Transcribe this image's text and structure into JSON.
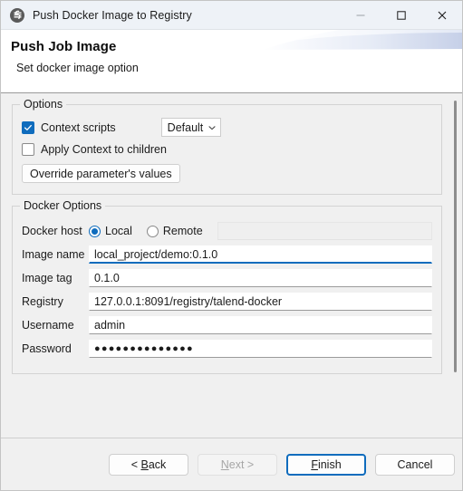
{
  "window": {
    "title": "Push Docker Image to Registry",
    "icon": "talend-logo-icon",
    "controls": {
      "minimize": "minimize-icon",
      "maximize": "maximize-icon",
      "close": "close-icon"
    }
  },
  "header": {
    "title": "Push Job Image",
    "subtitle": "Set docker image option"
  },
  "options": {
    "group_title": "Options",
    "context_scripts": {
      "label": "Context scripts",
      "checked": true
    },
    "context_combo": {
      "value": "Default",
      "arrow": "chevron-down-icon"
    },
    "apply_context": {
      "label": "Apply Context to children",
      "checked": false
    },
    "override_button": "Override parameter's values"
  },
  "docker": {
    "group_title": "Docker Options",
    "host": {
      "label": "Docker host",
      "local_label": "Local",
      "remote_label": "Remote",
      "selected": "Local",
      "remote_value": ""
    },
    "fields": [
      {
        "label": "Image name",
        "value": "local_project/demo:0.1.0",
        "focused": true,
        "type": "text"
      },
      {
        "label": "Image tag",
        "value": "0.1.0",
        "focused": false,
        "type": "text"
      },
      {
        "label": "Registry",
        "value": "127.0.0.1:8091/registry/talend-docker",
        "focused": false,
        "type": "text"
      },
      {
        "label": "Username",
        "value": "admin",
        "focused": false,
        "type": "text"
      },
      {
        "label": "Password",
        "value": "●●●●●●●●●●●●●●",
        "focused": false,
        "type": "password"
      }
    ]
  },
  "footer": {
    "back": {
      "pre": "< ",
      "mnemonic": "B",
      "post": "ack"
    },
    "next": {
      "pre": "",
      "mnemonic": "N",
      "post": "ext >"
    },
    "finish": {
      "pre": "",
      "mnemonic": "F",
      "post": "inish"
    },
    "cancel": {
      "pre": "",
      "mnemonic": "",
      "post": "Cancel"
    }
  },
  "colors": {
    "accent": "#0f6cbd",
    "titlebar": "#eef2f7",
    "dialog_bg": "#f0f0f0",
    "text": "#1b1b1b"
  }
}
